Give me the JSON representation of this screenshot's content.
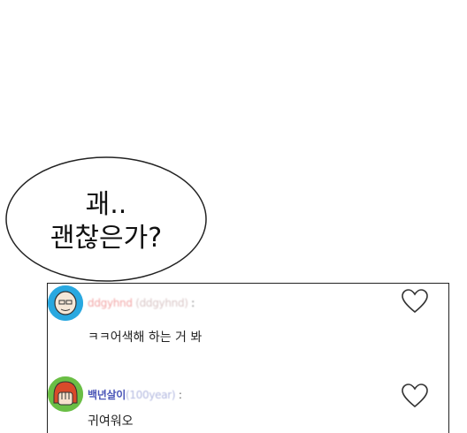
{
  "speech_bubble": {
    "line1": "괘..",
    "line2": "괜찮은가?"
  },
  "comments": [
    {
      "username": "ddgyhnd",
      "user_id_paren": "(ddgyhnd)",
      "separator": ":",
      "text": "ㅋㅋ어색해 하는 거 봐",
      "avatar_icon": "bald-man-avatar-icon",
      "avatar_bg": "#29a8e0",
      "like_icon": "heart-outline-icon"
    },
    {
      "username": "백년살이",
      "user_id_paren": "(100year)",
      "separator": ":",
      "text": "귀여워오",
      "avatar_icon": "red-hair-avatar-icon",
      "avatar_bg": "#6abe45",
      "like_icon": "heart-outline-icon"
    }
  ],
  "colors": {
    "username_blurred": "#f2a6a6",
    "username_2": "#4a55b8",
    "user_id": "#b3b9e0"
  }
}
